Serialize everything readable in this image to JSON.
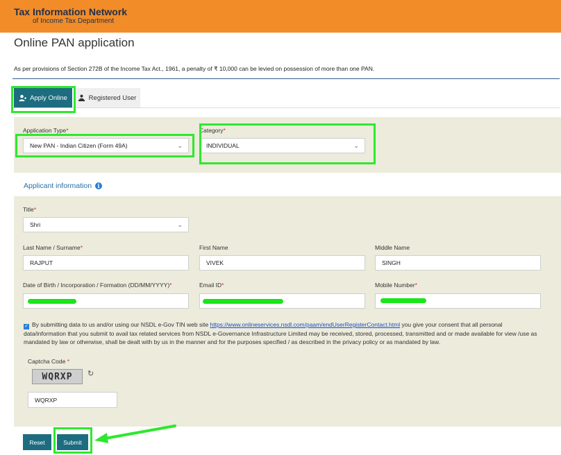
{
  "header": {
    "brand_line1": "Tax Information Network",
    "brand_line2": "of Income Tax Department",
    "bg_color": "#f28c28"
  },
  "page": {
    "title": "Online PAN application",
    "notice": "As per provisions of Section 272B of the Income Tax Act., 1961, a penalty of ₹ 10,000 can be levied on possession of more than one PAN."
  },
  "tabs": [
    {
      "label": "Apply Online",
      "icon": "user-plus-icon",
      "active": true
    },
    {
      "label": "Registered User",
      "icon": "user-group-icon",
      "active": false
    }
  ],
  "application": {
    "type_label": "Application Type",
    "type_value": "New PAN - Indian Citizen (Form 49A)",
    "category_label": "Category",
    "category_value": "INDIVIDUAL"
  },
  "applicant": {
    "heading": "Applicant information",
    "title_label": "Title",
    "title_value": "Shri",
    "last_name_label": "Last Name / Surname",
    "last_name_value": "RAJPUT",
    "first_name_label": "First Name",
    "first_name_value": "VIVEK",
    "middle_name_label": "Middle Name",
    "middle_name_value": "SINGH",
    "dob_label": "Date of Birth / Incorporation / Formation (DD/MM/YYYY)",
    "email_label": "Email ID",
    "mobile_label": "Mobile Number"
  },
  "consent": {
    "text_before": "By submitting data to us and/or using our NSDL e-Gov TIN web site ",
    "link": "https://www.onlineservices.nsdl.com/paam/endUserRegisterContact.html",
    "text_after": " you give your consent that all personal data/information that you submit to avail tax related services from NSDL e-Governance Infrastructure Limited may be received, stored, processed, transmitted and or made available for view /use as mandated by law or otherwise, shall be dealt with by us in the manner and for the purposes specified / as described in the privacy policy or as mandated by law.",
    "checked": true
  },
  "captcha": {
    "label": "Captcha Code",
    "image_text": "WQRXP",
    "input_value": "WQRXP"
  },
  "buttons": {
    "reset": "Reset",
    "submit": "Submit"
  },
  "annotation_color": "#2ee82e"
}
